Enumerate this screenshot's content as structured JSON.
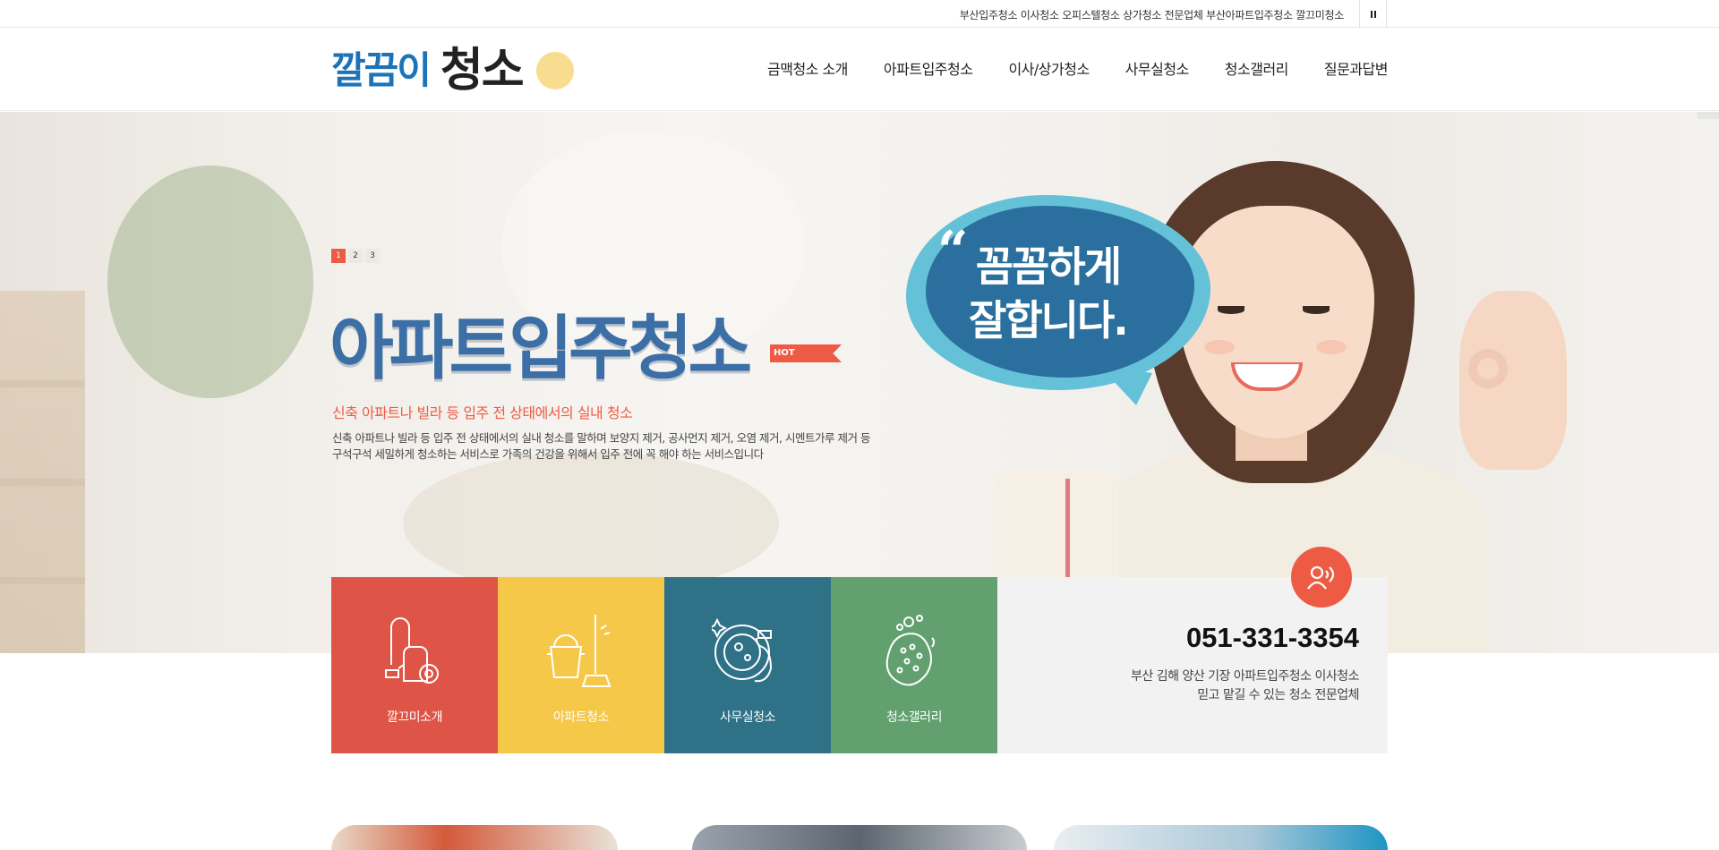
{
  "topbar": {
    "text": "부산입주청소 이사청소 오피스텔청소 상가청소 전문업체 부산아파트입주청소 깔끄미청소",
    "pause_icon": "pause-icon"
  },
  "header": {
    "logo_part1": "깔끔이",
    "logo_part2": "청소",
    "nav": [
      "금맥청소 소개",
      "아파트입주청소",
      "이사/상가청소",
      "사무실청소",
      "청소갤러리",
      "질문과답변"
    ]
  },
  "hero": {
    "slides": [
      "1",
      "2",
      "3"
    ],
    "active_slide": 1,
    "title": "아파트입주청소",
    "hot_badge": "HOT",
    "subtitle": "신축 아파트나 빌라 등 입주 전 상태에서의 실내 청소",
    "description_line1": "신축 아파트나 빌라 등 입주 전 상태에서의 실내 청소를 말하며 보양지 제거, 공사먼지 제거, 오염 제거, 시멘트가루 제거 등",
    "description_line2": "구석구석 세밀하게 청소하는 서비스로 가족의 건강을 위해서 입주 전에 꼭 해야 하는 서비스입니다",
    "bubble_quote": "“",
    "bubble_line1": "꼼꼼하게",
    "bubble_line2": "잘합니다."
  },
  "services": [
    {
      "label": "깔끄미소개",
      "icon": "vacuum-cleaner-icon",
      "color": "#de5446"
    },
    {
      "label": "아파트청소",
      "icon": "bucket-mop-icon",
      "color": "#f5c84a"
    },
    {
      "label": "사무실청소",
      "icon": "dish-sponge-icon",
      "color": "#2f7287"
    },
    {
      "label": "청소갤러리",
      "icon": "soap-sponge-icon",
      "color": "#62a06f"
    }
  ],
  "contact": {
    "icon": "phone-call-icon",
    "phone": "051-331-3354",
    "line1": "부산 김해 양산 기장 아파트입주청소 이사청소",
    "line2": "믿고 맡길 수 있는 청소 전문업체"
  },
  "colors": {
    "accent": "#ee5b44",
    "brand_blue": "#1d73b8",
    "title_blue": "#3b6fa6"
  }
}
